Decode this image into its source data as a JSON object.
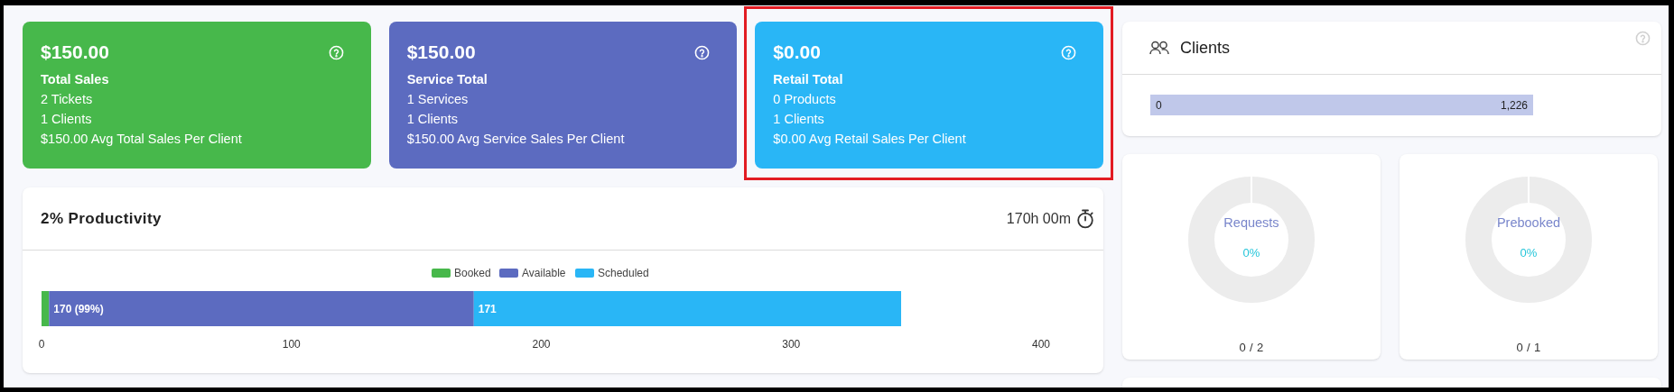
{
  "summary_cards": [
    {
      "kind": "sales",
      "value": "$150.00",
      "title": "Total Sales",
      "lines": [
        "2 Tickets",
        "1 Clients",
        "$150.00 Avg Total Sales Per Client"
      ],
      "highlighted": false
    },
    {
      "kind": "service",
      "value": "$150.00",
      "title": "Service Total",
      "lines": [
        "1 Services",
        "1 Clients",
        "$150.00 Avg Service Sales Per Client"
      ],
      "highlighted": false
    },
    {
      "kind": "retail",
      "value": "$0.00",
      "title": "Retail Total",
      "lines": [
        "0 Products",
        "1 Clients",
        "$0.00 Avg Retail Sales Per Client"
      ],
      "highlighted": true
    }
  ],
  "productivity": {
    "title": "2% Productivity",
    "duration": "170h 00m",
    "chart_data": {
      "type": "bar",
      "orientation": "horizontal",
      "stacked": true,
      "legend": "top",
      "series": [
        {
          "name": "Booked",
          "color": "#47b84b",
          "values": [
            3
          ]
        },
        {
          "name": "Available",
          "color": "#5c6bc0",
          "values": [
            170
          ]
        },
        {
          "name": "Scheduled",
          "color": "#29b6f6",
          "values": [
            171
          ]
        }
      ],
      "value_labels": [
        null,
        "170 (99%)",
        "171"
      ],
      "xlim": [
        0,
        400
      ],
      "xticks": [
        0,
        100,
        200,
        300,
        400
      ]
    }
  },
  "clients": {
    "title": "Clients",
    "range_min": "0",
    "range_max": "1,226"
  },
  "donuts": [
    {
      "label": "Requests",
      "percent": "0%",
      "total": "0 / 2"
    },
    {
      "label": "Prebooked",
      "percent": "0%",
      "total": "0 / 1"
    }
  ]
}
